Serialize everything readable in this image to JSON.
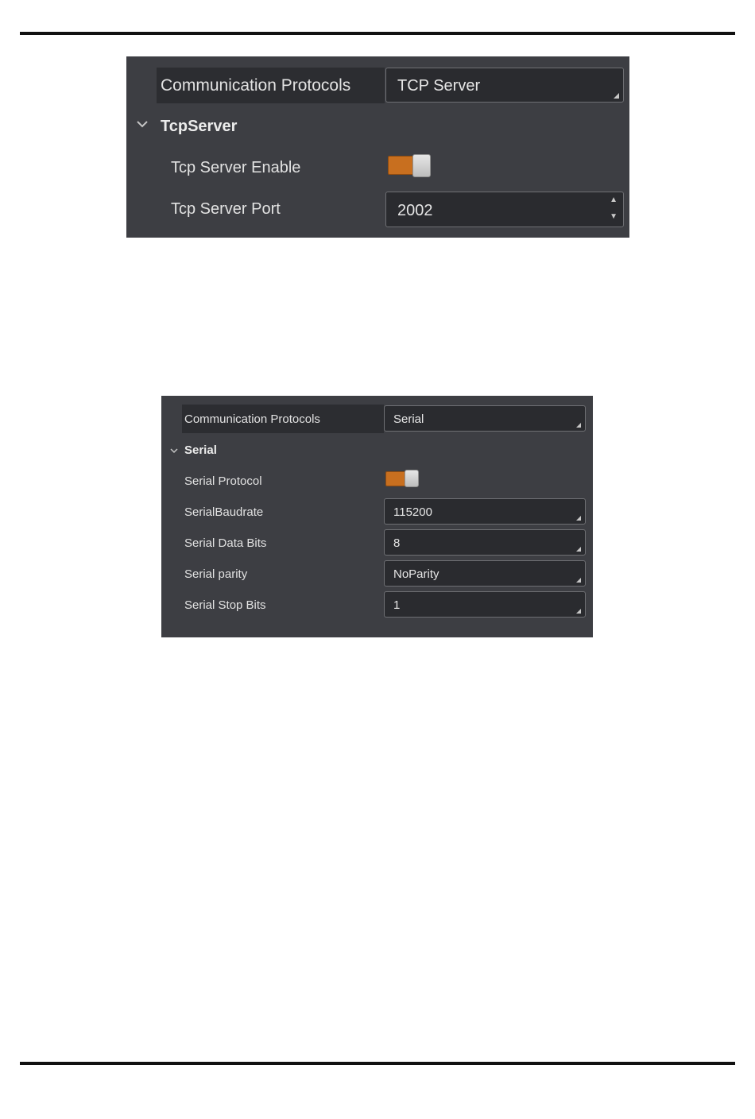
{
  "tcp_panel": {
    "protocol_label": "Communication Protocols",
    "protocol_value": "TCP Server",
    "group_title": "TcpServer",
    "enable_label": "Tcp Server Enable",
    "enable_on": true,
    "port_label": "Tcp Server Port",
    "port_value": "2002"
  },
  "serial_panel": {
    "protocol_label": "Communication Protocols",
    "protocol_value": "Serial",
    "group_title": "Serial",
    "protocol_toggle_label": "Serial Protocol",
    "protocol_toggle_on": true,
    "baudrate_label": "SerialBaudrate",
    "baudrate_value": "115200",
    "data_bits_label": "Serial Data Bits",
    "data_bits_value": "8",
    "parity_label": "Serial parity",
    "parity_value": "NoParity",
    "stop_bits_label": "Serial Stop Bits",
    "stop_bits_value": "1"
  },
  "colors": {
    "panel_bg": "#3d3e43",
    "field_bg": "#2a2b2f",
    "toggle_accent": "#c86f1f"
  }
}
